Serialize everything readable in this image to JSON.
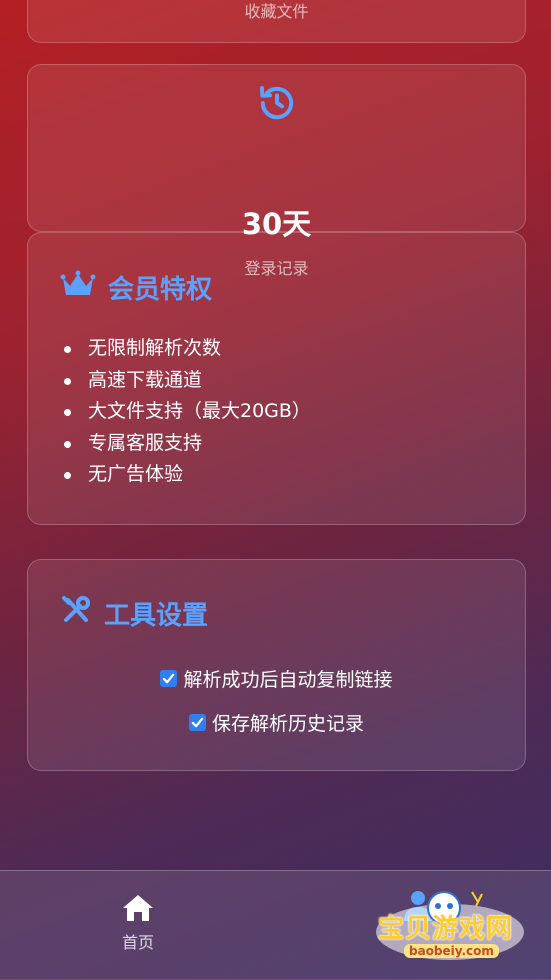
{
  "stats": {
    "favorites": {
      "label": "收藏文件"
    },
    "login": {
      "value": "30天",
      "label": "登录记录",
      "icon": "history-icon"
    }
  },
  "membership": {
    "title": "会员特权",
    "icon": "crown-icon",
    "benefits": [
      "无限制解析次数",
      "高速下载通道",
      "大文件支持（最大20GB）",
      "专属客服支持",
      "无广告体验"
    ]
  },
  "tools": {
    "title": "工具设置",
    "icon": "tools-icon",
    "options": [
      {
        "label": "解析成功后自动复制链接",
        "checked": true
      },
      {
        "label": "保存解析历史记录",
        "checked": true
      }
    ]
  },
  "nav": {
    "home": {
      "label": "首页",
      "icon": "home-icon"
    },
    "user": {
      "icon": "user-icon"
    }
  },
  "watermark": {
    "title": "宝贝游戏网",
    "url": "baobeiy.com"
  },
  "colors": {
    "accent": "#5aa2ff",
    "checkbox": "#2f7ff0",
    "bg_top": "#b41f24",
    "bg_bottom": "#3c2d62"
  }
}
